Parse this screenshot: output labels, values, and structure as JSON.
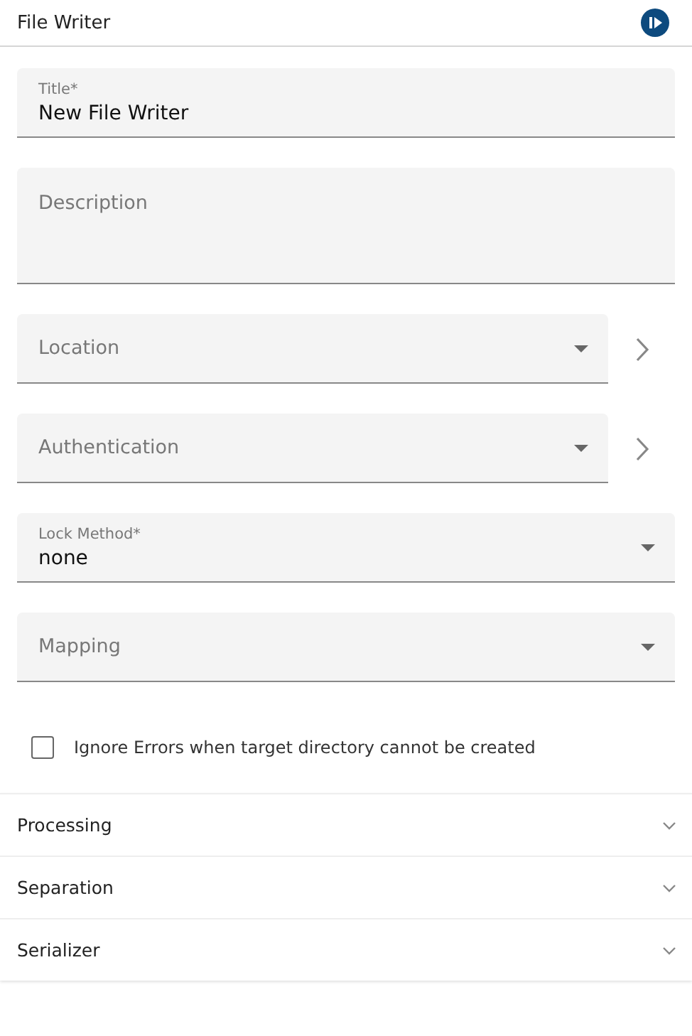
{
  "header": {
    "title": "File Writer"
  },
  "fields": [
    {
      "kind": "text",
      "label": "Title*",
      "value": "New File Writer"
    },
    {
      "kind": "textarea",
      "placeholder": "Description"
    },
    {
      "kind": "select",
      "placeholder": "Location",
      "navigate": true
    },
    {
      "kind": "select",
      "placeholder": "Authentication",
      "navigate": true
    },
    {
      "kind": "select",
      "label": "Lock Method*",
      "value": "none"
    },
    {
      "kind": "select",
      "placeholder": "Mapping"
    }
  ],
  "checkbox": {
    "label": "Ignore Errors when target directory cannot be created",
    "checked": false
  },
  "sections": [
    {
      "title": "Processing",
      "expanded": false
    },
    {
      "title": "Separation",
      "expanded": false
    },
    {
      "title": "Serializer",
      "expanded": false
    }
  ]
}
